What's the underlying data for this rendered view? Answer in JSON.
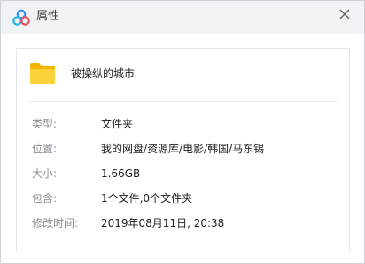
{
  "window": {
    "title": "属性",
    "logo_icon": "cloud-logo-icon",
    "close_icon": "close-icon"
  },
  "file": {
    "icon": "folder-icon",
    "name": "被操纵的城市"
  },
  "properties": {
    "type": {
      "label": "类型:",
      "value": "文件夹"
    },
    "location": {
      "label": "位置:",
      "value": "我的网盘/资源库/电影/韩国/马东锡"
    },
    "size": {
      "label": "大小:",
      "value": "1.66GB"
    },
    "contains": {
      "label": "包含:",
      "value": "1个文件,0个文件夹"
    },
    "modified": {
      "label": "修改时间:",
      "value": "2019年08月11日, 20:38"
    }
  },
  "colors": {
    "titlebar_bg": "#f0f2f5",
    "folder_yellow": "#fbc82d",
    "label_gray": "#8a8f96",
    "text_dark": "#222222"
  }
}
